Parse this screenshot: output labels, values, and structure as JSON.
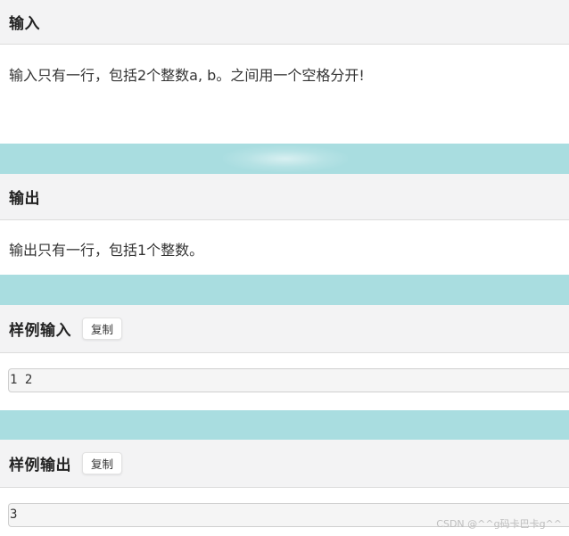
{
  "input_section": {
    "title": "输入",
    "text": "输入只有一行，包括2个整数a, b。之间用一个空格分开!"
  },
  "output_section": {
    "title": "输出",
    "text": "输出只有一行，包括1个整数。"
  },
  "sample_input": {
    "title": "样例输入",
    "copy_label": "复制",
    "code": "1 2"
  },
  "sample_output": {
    "title": "样例输出",
    "copy_label": "复制",
    "code": "3"
  },
  "watermark": "CSDN @^^g码卡巴卡g^^",
  "colors": {
    "separator": "#a9dde0",
    "header_bg": "#f3f3f4"
  }
}
